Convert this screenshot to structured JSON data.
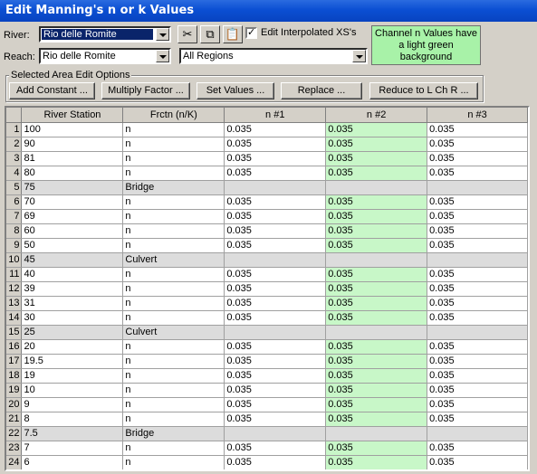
{
  "window": {
    "title": "Edit Manning's n or k Values"
  },
  "controls": {
    "river_label": "River:",
    "river_value": "Rio delle Romite",
    "reach_label": "Reach:",
    "reach_value": "Rio delle Romite",
    "region_value": "All Regions",
    "edit_interpolated_label": "Edit Interpolated XS's",
    "edit_interpolated_checked": "✓",
    "icons": [
      "scissors-icon",
      "copy-icon",
      "paste-icon"
    ],
    "note": "Channel n Values have a light green background",
    "note_color": "#a8f2a8"
  },
  "edit_options": {
    "label": "Selected Area Edit Options",
    "buttons": [
      "Add Constant ...",
      "Multiply Factor ...",
      "Set Values ...",
      "Replace ...",
      "Reduce to L Ch R ..."
    ]
  },
  "table": {
    "headers": [
      "River Station",
      "Frctn (n/K)",
      "n #1",
      "n #2",
      "n #3"
    ],
    "channel_color": "#c8f7c8",
    "rows": [
      {
        "num": "1",
        "station": "100",
        "type": "n",
        "n1": "0.035",
        "n2": "0.035",
        "n3": "0.035"
      },
      {
        "num": "2",
        "station": "90",
        "type": "n",
        "n1": "0.035",
        "n2": "0.035",
        "n3": "0.035"
      },
      {
        "num": "3",
        "station": "81",
        "type": "n",
        "n1": "0.035",
        "n2": "0.035",
        "n3": "0.035"
      },
      {
        "num": "4",
        "station": "80",
        "type": "n",
        "n1": "0.035",
        "n2": "0.035",
        "n3": "0.035"
      },
      {
        "num": "5",
        "station": "75",
        "type": "Bridge",
        "n1": "",
        "n2": "",
        "n3": ""
      },
      {
        "num": "6",
        "station": "70",
        "type": "n",
        "n1": "0.035",
        "n2": "0.035",
        "n3": "0.035"
      },
      {
        "num": "7",
        "station": "69",
        "type": "n",
        "n1": "0.035",
        "n2": "0.035",
        "n3": "0.035"
      },
      {
        "num": "8",
        "station": "60",
        "type": "n",
        "n1": "0.035",
        "n2": "0.035",
        "n3": "0.035"
      },
      {
        "num": "9",
        "station": "50",
        "type": "n",
        "n1": "0.035",
        "n2": "0.035",
        "n3": "0.035"
      },
      {
        "num": "10",
        "station": "45",
        "type": "Culvert",
        "n1": "",
        "n2": "",
        "n3": ""
      },
      {
        "num": "11",
        "station": "40",
        "type": "n",
        "n1": "0.035",
        "n2": "0.035",
        "n3": "0.035"
      },
      {
        "num": "12",
        "station": "39",
        "type": "n",
        "n1": "0.035",
        "n2": "0.035",
        "n3": "0.035"
      },
      {
        "num": "13",
        "station": "31",
        "type": "n",
        "n1": "0.035",
        "n2": "0.035",
        "n3": "0.035"
      },
      {
        "num": "14",
        "station": "30",
        "type": "n",
        "n1": "0.035",
        "n2": "0.035",
        "n3": "0.035"
      },
      {
        "num": "15",
        "station": "25",
        "type": "Culvert",
        "n1": "",
        "n2": "",
        "n3": ""
      },
      {
        "num": "16",
        "station": "20",
        "type": "n",
        "n1": "0.035",
        "n2": "0.035",
        "n3": "0.035"
      },
      {
        "num": "17",
        "station": "19.5",
        "type": "n",
        "n1": "0.035",
        "n2": "0.035",
        "n3": "0.035"
      },
      {
        "num": "18",
        "station": "19",
        "type": "n",
        "n1": "0.035",
        "n2": "0.035",
        "n3": "0.035"
      },
      {
        "num": "19",
        "station": "10",
        "type": "n",
        "n1": "0.035",
        "n2": "0.035",
        "n3": "0.035"
      },
      {
        "num": "20",
        "station": "9",
        "type": "n",
        "n1": "0.035",
        "n2": "0.035",
        "n3": "0.035"
      },
      {
        "num": "21",
        "station": "8",
        "type": "n",
        "n1": "0.035",
        "n2": "0.035",
        "n3": "0.035"
      },
      {
        "num": "22",
        "station": "7.5",
        "type": "Bridge",
        "n1": "",
        "n2": "",
        "n3": ""
      },
      {
        "num": "23",
        "station": "7",
        "type": "n",
        "n1": "0.035",
        "n2": "0.035",
        "n3": "0.035"
      },
      {
        "num": "24",
        "station": "6",
        "type": "n",
        "n1": "0.035",
        "n2": "0.035",
        "n3": "0.035"
      }
    ]
  }
}
